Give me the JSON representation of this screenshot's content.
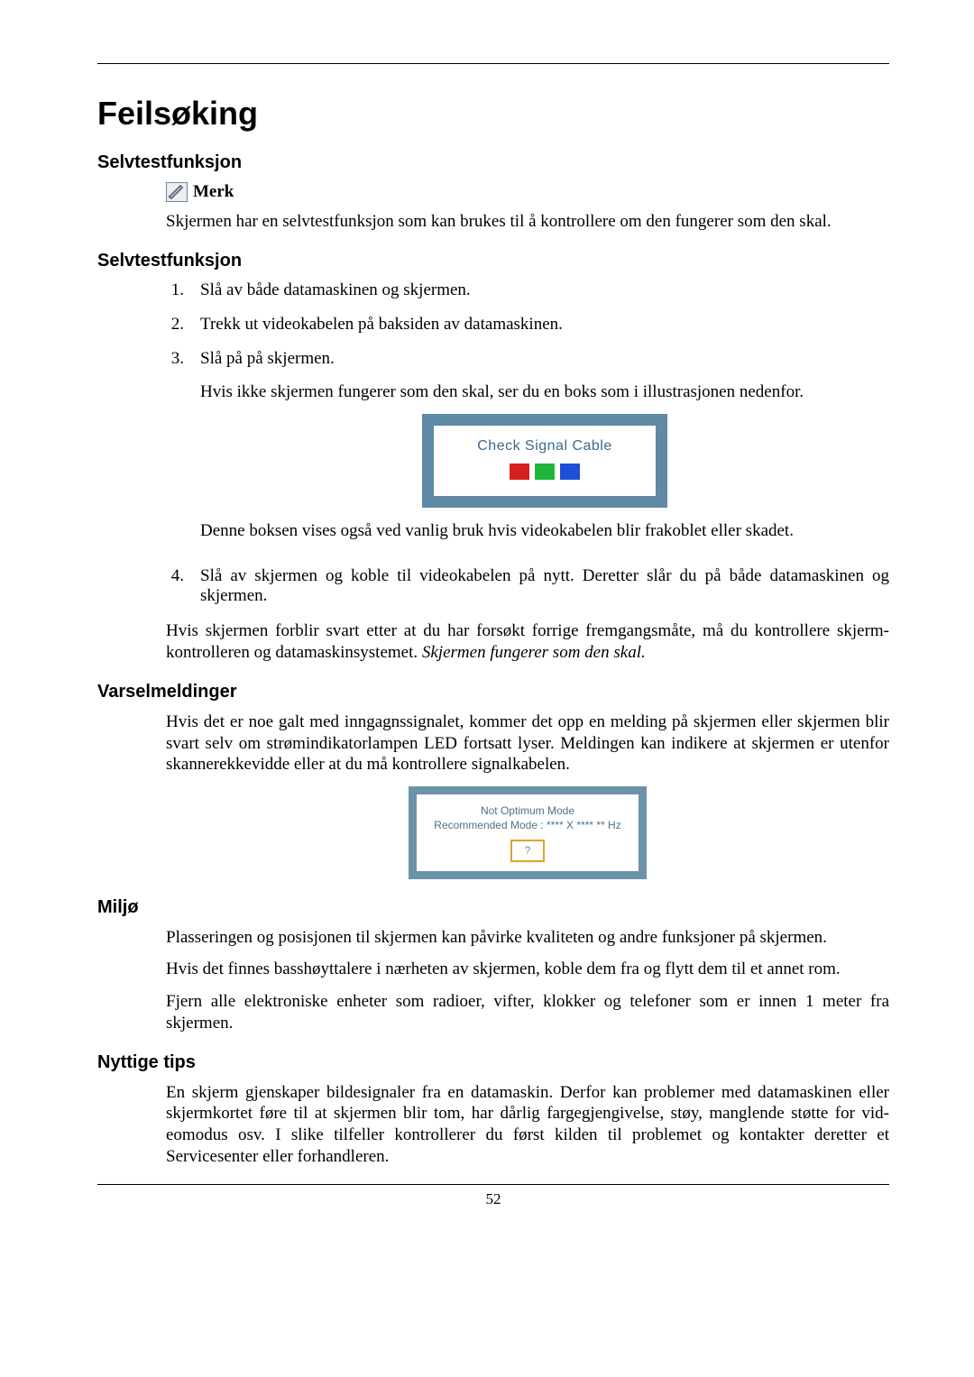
{
  "page_number": "52",
  "title": "Feilsøking",
  "note_label": "Merk",
  "sections": {
    "selftest1": {
      "heading": "Selvtestfunksjon",
      "intro": "Skjermen har en selvtestfunksjon som kan brukes til å kontrollere om den fungerer som den skal."
    },
    "selftest2": {
      "heading": "Selvtestfunksjon",
      "steps": {
        "s1": {
          "num": "1.",
          "text": "Slå av både datamaskinen og skjermen."
        },
        "s2": {
          "num": "2.",
          "text": "Trekk ut videokabelen på baksiden av datamaskinen."
        },
        "s3": {
          "num": "3.",
          "text": "Slå på på skjermen.",
          "sub1": "Hvis ikke skjermen fungerer som den skal, ser du en boks som i illustrasjonen nedenfor.",
          "sub2": "Denne boksen vises også ved vanlig bruk hvis videokabelen blir frakoblet eller skadet."
        },
        "s4": {
          "num": "4.",
          "text": "Slå av skjermen og koble til videokabelen på nytt. Deretter slår du på både datamaskinen og skjermen."
        }
      },
      "image_text": "Check Signal Cable",
      "after": {
        "line": "Hvis skjermen forblir svart etter at du har forsøkt forrige fremgangsmåte, må du kontrollere skjerm-kontrolleren og datamaskinsystemet. ",
        "italic": "Skjermen fungerer som den skal."
      }
    },
    "warnings": {
      "heading": "Varselmeldinger",
      "text": "Hvis det er noe galt med inngagnssignalet, kommer det opp en melding på skjermen eller skjermen blir svart selv om strømindikatorlampen LED fortsatt lyser. Meldingen kan indikere at skjermen er utenfor skannerekkevidde eller at du må kontrollere signalkabelen.",
      "image": {
        "line1": "Not Optimum Mode",
        "line2": "Recommended Mode : **** X **** ** Hz",
        "btn": "?"
      }
    },
    "env": {
      "heading": "Miljø",
      "p1": "Plasseringen og posisjonen til skjermen kan påvirke kvaliteten og andre funksjoner på skjermen.",
      "p2": "Hvis det finnes basshøyttalere i nærheten av skjermen, koble dem fra og flytt dem til et annet rom.",
      "p3": "Fjern alle elektroniske enheter som radioer, vifter, klokker og telefoner som er innen 1 meter fra skjermen."
    },
    "tips": {
      "heading": "Nyttige tips",
      "p1": "En skjerm gjenskaper bildesignaler fra en datamaskin. Derfor kan problemer med datamaskinen eller skjermkortet føre til at skjermen blir tom, har dårlig fargegjengivelse, støy, manglende støtte for vid-eomodus osv. I slike tilfeller kontrollerer du først kilden til problemet og kontakter deretter et Servicesenter eller forhandleren."
    }
  }
}
